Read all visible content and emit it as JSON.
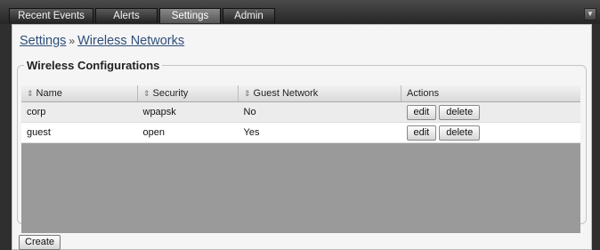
{
  "tabs": [
    {
      "label": "Recent Events",
      "active": false
    },
    {
      "label": "Alerts",
      "active": false
    },
    {
      "label": "Settings",
      "active": true
    },
    {
      "label": "Admin",
      "active": false
    }
  ],
  "menu_toggle_icon": "chevron-down-icon",
  "breadcrumb": {
    "root": "Settings",
    "separator": "»",
    "current": "Wireless Networks"
  },
  "section": {
    "title": "Wireless Configurations"
  },
  "table": {
    "sort_icon": "⇕",
    "columns": [
      "Name",
      "Security",
      "Guest Network",
      "Actions"
    ],
    "rows": [
      {
        "name": "corp",
        "security": "wpapsk",
        "guest": "No",
        "edit": "edit",
        "delete": "delete"
      },
      {
        "name": "guest",
        "security": "open",
        "guest": "Yes",
        "edit": "edit",
        "delete": "delete"
      }
    ]
  },
  "create_button": "Create",
  "colors": {
    "top_bar": "#262626",
    "panel_bg": "#f5f5f5",
    "grid_empty": "#9a9a9a",
    "link": "#2f4f7a"
  }
}
